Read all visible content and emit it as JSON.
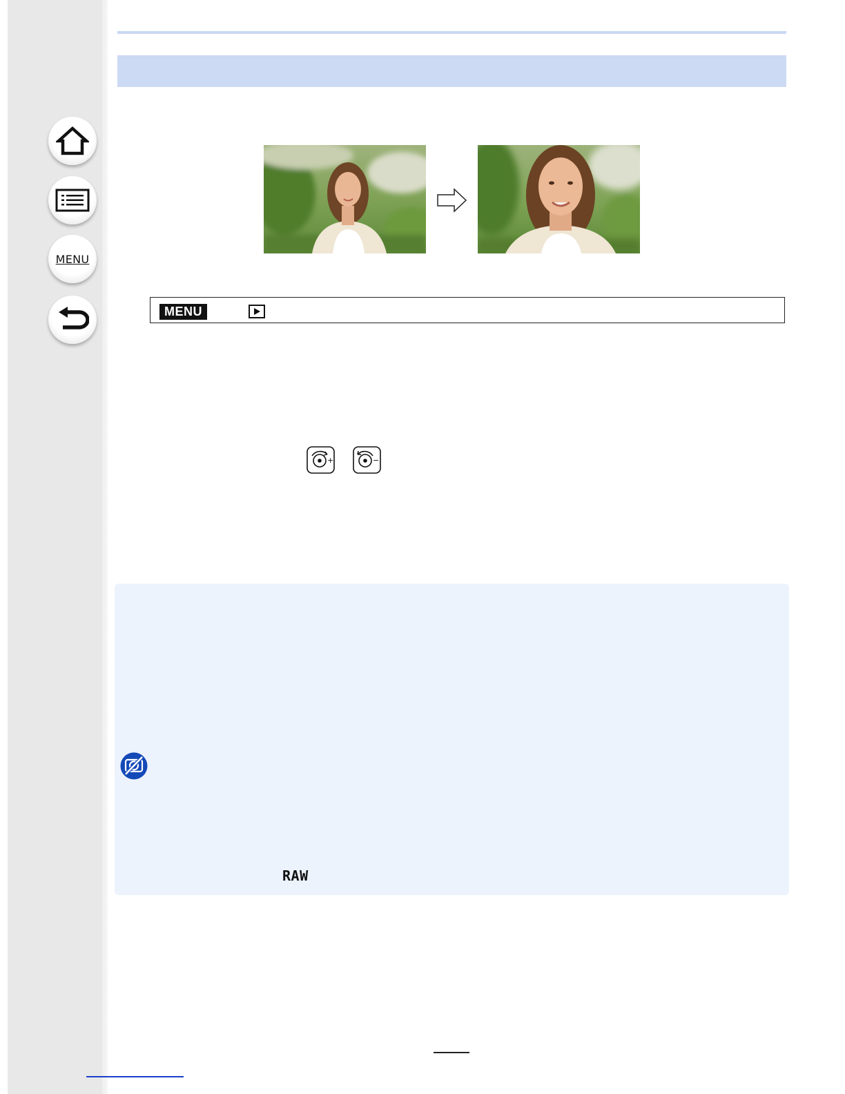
{
  "sidebar": {
    "items": [
      {
        "icon": "home-icon"
      },
      {
        "icon": "contents-list-icon"
      },
      {
        "icon": "menu-icon",
        "label": "MENU"
      },
      {
        "icon": "back-icon"
      }
    ]
  },
  "menu_path": {
    "badge": "MENU",
    "icon": "playback-icon"
  },
  "dials": [
    {
      "icon": "dial-rotate-plus-icon"
    },
    {
      "icon": "dial-rotate-minus-icon"
    }
  ],
  "note": {
    "icon": "not-available-icon",
    "raw_label": "RAW"
  },
  "colors": {
    "sidebar": "#e8e8e8",
    "title_band": "#ccdaf3",
    "note_panel": "#edf3fd",
    "note_icon": "#1449b8",
    "link": "#1a3fc9"
  }
}
